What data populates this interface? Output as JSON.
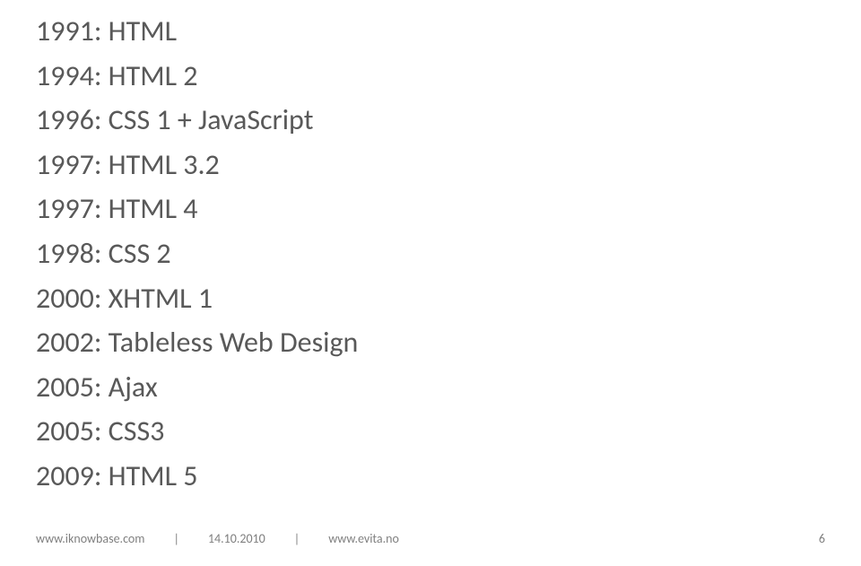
{
  "timeline": [
    "1991: HTML",
    "1994: HTML 2",
    "1996: CSS 1 + JavaScript",
    "1997: HTML 3.2",
    "1997: HTML 4",
    "1998: CSS 2",
    "2000: XHTML 1",
    "2002: Tableless Web Design",
    "2005: Ajax",
    "2005: CSS3",
    "2009: HTML 5"
  ],
  "footer": {
    "left_url": "www.iknowbase.com",
    "date": "14.10.2010",
    "right_url": "www.evita.no",
    "separator": "|",
    "page_number": "6"
  }
}
